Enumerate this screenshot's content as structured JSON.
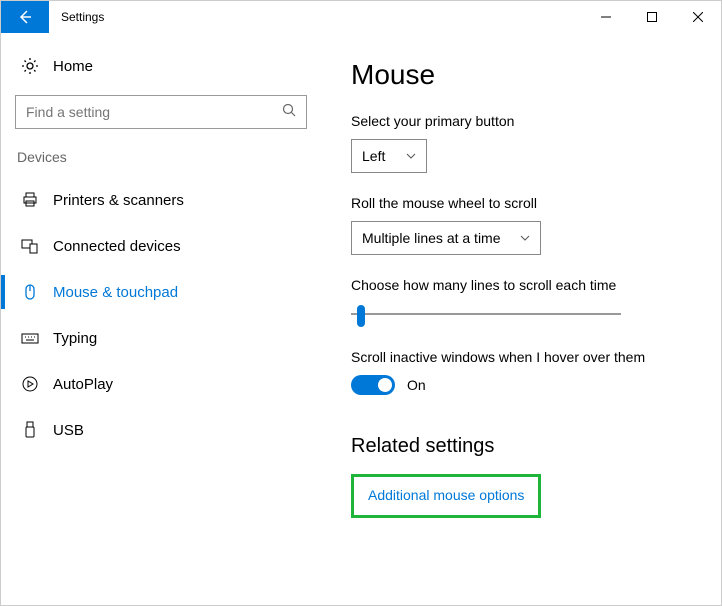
{
  "titlebar": {
    "title": "Settings"
  },
  "sidebar": {
    "home": "Home",
    "search_placeholder": "Find a setting",
    "group": "Devices",
    "items": [
      {
        "label": "Printers & scanners"
      },
      {
        "label": "Connected devices"
      },
      {
        "label": "Mouse & touchpad"
      },
      {
        "label": "Typing"
      },
      {
        "label": "AutoPlay"
      },
      {
        "label": "USB"
      }
    ]
  },
  "main": {
    "title": "Mouse",
    "primary_label": "Select your primary button",
    "primary_value": "Left",
    "roll_label": "Roll the mouse wheel to scroll",
    "roll_value": "Multiple lines at a time",
    "lines_label": "Choose how many lines to scroll each time",
    "inactive_label": "Scroll inactive windows when I hover over them",
    "toggle_state": "On",
    "related_title": "Related settings",
    "related_link": "Additional mouse options"
  }
}
